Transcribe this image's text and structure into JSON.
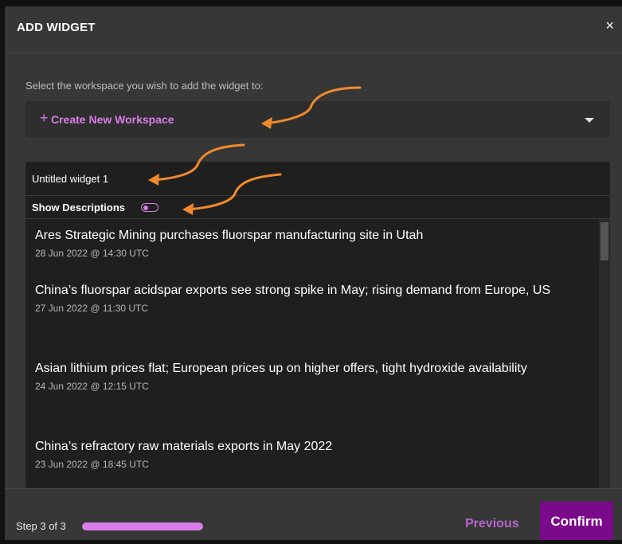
{
  "modal": {
    "title": "ADD WIDGET",
    "close_symbol": "×"
  },
  "workspace": {
    "label": "Select the workspace you wish to add the widget to:",
    "plus_symbol": "+",
    "selected": "Create New Workspace"
  },
  "widget": {
    "name": "Untitled widget 1",
    "show_descriptions_label": "Show Descriptions",
    "show_descriptions_on": false,
    "news": [
      {
        "title": "Ares Strategic Mining purchases fluorspar manufacturing site in Utah",
        "date": "28 Jun 2022 @ 14:30 UTC"
      },
      {
        "title": "China’s fluorspar acidspar exports see strong spike in May; rising demand from Europe, US",
        "date": "27 Jun 2022 @ 11:30 UTC"
      },
      {
        "title": "Asian lithium prices flat; European prices up on higher offers, tight hydroxide availability",
        "date": "24 Jun 2022 @ 12:15 UTC"
      },
      {
        "title": "China’s refractory raw materials exports in May 2022",
        "date": "23 Jun 2022 @ 18:45 UTC"
      }
    ]
  },
  "footer": {
    "step_text": "Step 3 of 3",
    "progress_fraction": 1.0,
    "previous_label": "Previous",
    "confirm_label": "Confirm"
  },
  "colors": {
    "accent": "#d97ee8",
    "confirm_bg": "#7b0a8a",
    "annotation_arrow": "#f08a2c"
  }
}
